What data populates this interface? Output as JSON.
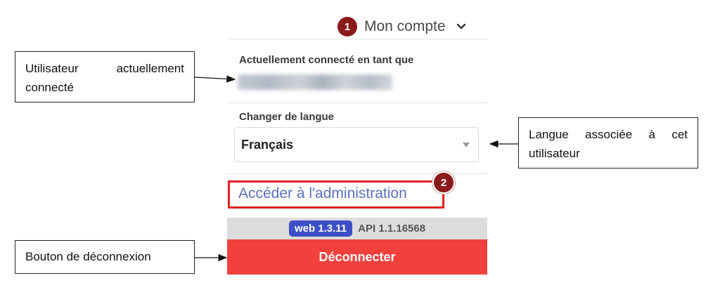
{
  "account_menu": {
    "step_number": "1",
    "title": "Mon compte",
    "chevron_icon": "chevron-down-icon",
    "logged_in_label": "Actuellement connecté en tant que",
    "change_language_label": "Changer de langue",
    "language_selected": "Français",
    "admin_step_number": "2",
    "admin_link": "Accéder à l'administration",
    "web_version": "web 1.3.11",
    "api_version": "API 1.1.16568",
    "logout_label": "Déconnecter"
  },
  "callouts": {
    "current_user": "Utilisateur actuellement connecté",
    "language": "Langue associée à cet utilisateur",
    "logout": "Bouton de déconnexion"
  },
  "colors": {
    "badge": "#8b1a1a",
    "highlight_border": "#e02020",
    "link": "#5a6fbf",
    "web_badge": "#3c4fc7",
    "logout": "#f2413d"
  }
}
